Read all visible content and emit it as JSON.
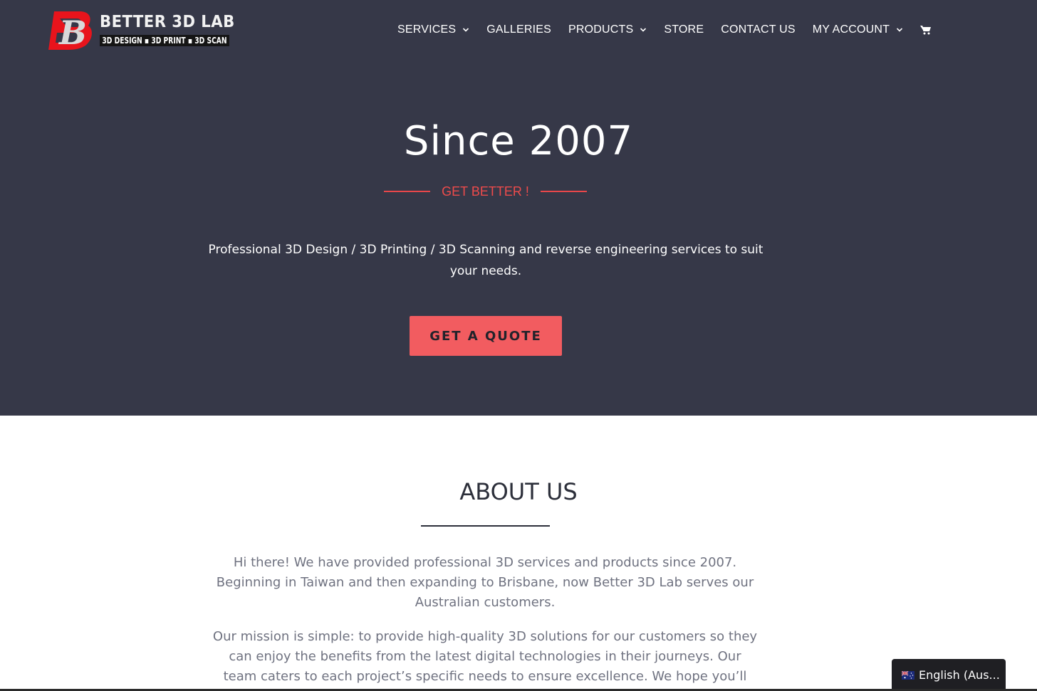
{
  "brand": {
    "name": "BETTER 3D LAB",
    "tagline": "3D DESIGN ▪ 3D PRINT ▪ 3D SCAN",
    "mark_letter": "B",
    "mark_color": "#e8141c"
  },
  "nav": {
    "items": [
      {
        "label": "SERVICES",
        "has_dropdown": true
      },
      {
        "label": "GALLERIES",
        "has_dropdown": false
      },
      {
        "label": "PRODUCTS",
        "has_dropdown": true
      },
      {
        "label": "STORE",
        "has_dropdown": false
      },
      {
        "label": "CONTACT US",
        "has_dropdown": false
      },
      {
        "label": "MY ACCOUNT",
        "has_dropdown": true
      }
    ],
    "cart_icon": "cart-icon"
  },
  "hero": {
    "title": "Since 2007",
    "tagline": "GET BETTER !",
    "description": "Professional 3D Design / 3D Printing / 3D Scanning and reverse engineering services to suit your needs.",
    "cta_label": "GET A QUOTE",
    "background": "#363848",
    "accent": "#f25c60"
  },
  "about": {
    "title": "ABOUT US",
    "paragraph1": "Hi there! We have provided professional 3D services and products since 2007. Beginning in Taiwan and then expanding to Brisbane, now Better 3D Lab serves our Australian customers.",
    "paragraph2": "Our mission is simple: to provide high-quality 3D solutions for our customers so they can enjoy the benefits from the latest digital technologies in their journeys. Our team caters to each project’s specific needs to ensure excellence. We hope you’ll find what you’re"
  },
  "language_switcher": {
    "label": "English (Aus...",
    "flag_icon": "australia-flag-icon"
  }
}
